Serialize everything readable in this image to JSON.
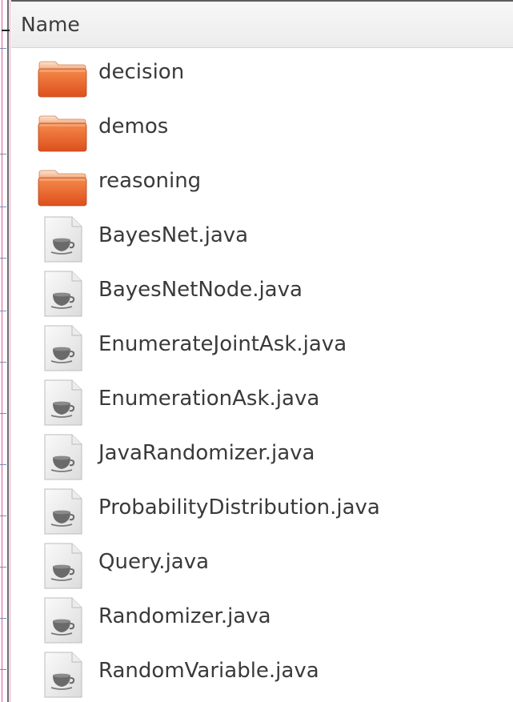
{
  "header": {
    "name_label": "Name"
  },
  "files": [
    {
      "label": "decision",
      "kind": "folder",
      "icon": "folder-icon"
    },
    {
      "label": "demos",
      "kind": "folder",
      "icon": "folder-icon"
    },
    {
      "label": "reasoning",
      "kind": "folder",
      "icon": "folder-icon"
    },
    {
      "label": "BayesNet.java",
      "kind": "file",
      "icon": "java-file-icon"
    },
    {
      "label": "BayesNetNode.java",
      "kind": "file",
      "icon": "java-file-icon"
    },
    {
      "label": "EnumerateJointAsk.java",
      "kind": "file",
      "icon": "java-file-icon"
    },
    {
      "label": "EnumerationAsk.java",
      "kind": "file",
      "icon": "java-file-icon"
    },
    {
      "label": "JavaRandomizer.java",
      "kind": "file",
      "icon": "java-file-icon"
    },
    {
      "label": "ProbabilityDistribution.java",
      "kind": "file",
      "icon": "java-file-icon"
    },
    {
      "label": "Query.java",
      "kind": "file",
      "icon": "java-file-icon"
    },
    {
      "label": "Randomizer.java",
      "kind": "file",
      "icon": "java-file-icon"
    },
    {
      "label": "RandomVariable.java",
      "kind": "file",
      "icon": "java-file-icon"
    }
  ],
  "colors": {
    "folder_top": "#f6a16a",
    "folder_body": "#e8622a",
    "text": "#3a3a3a",
    "header_bg": "#efefef"
  }
}
